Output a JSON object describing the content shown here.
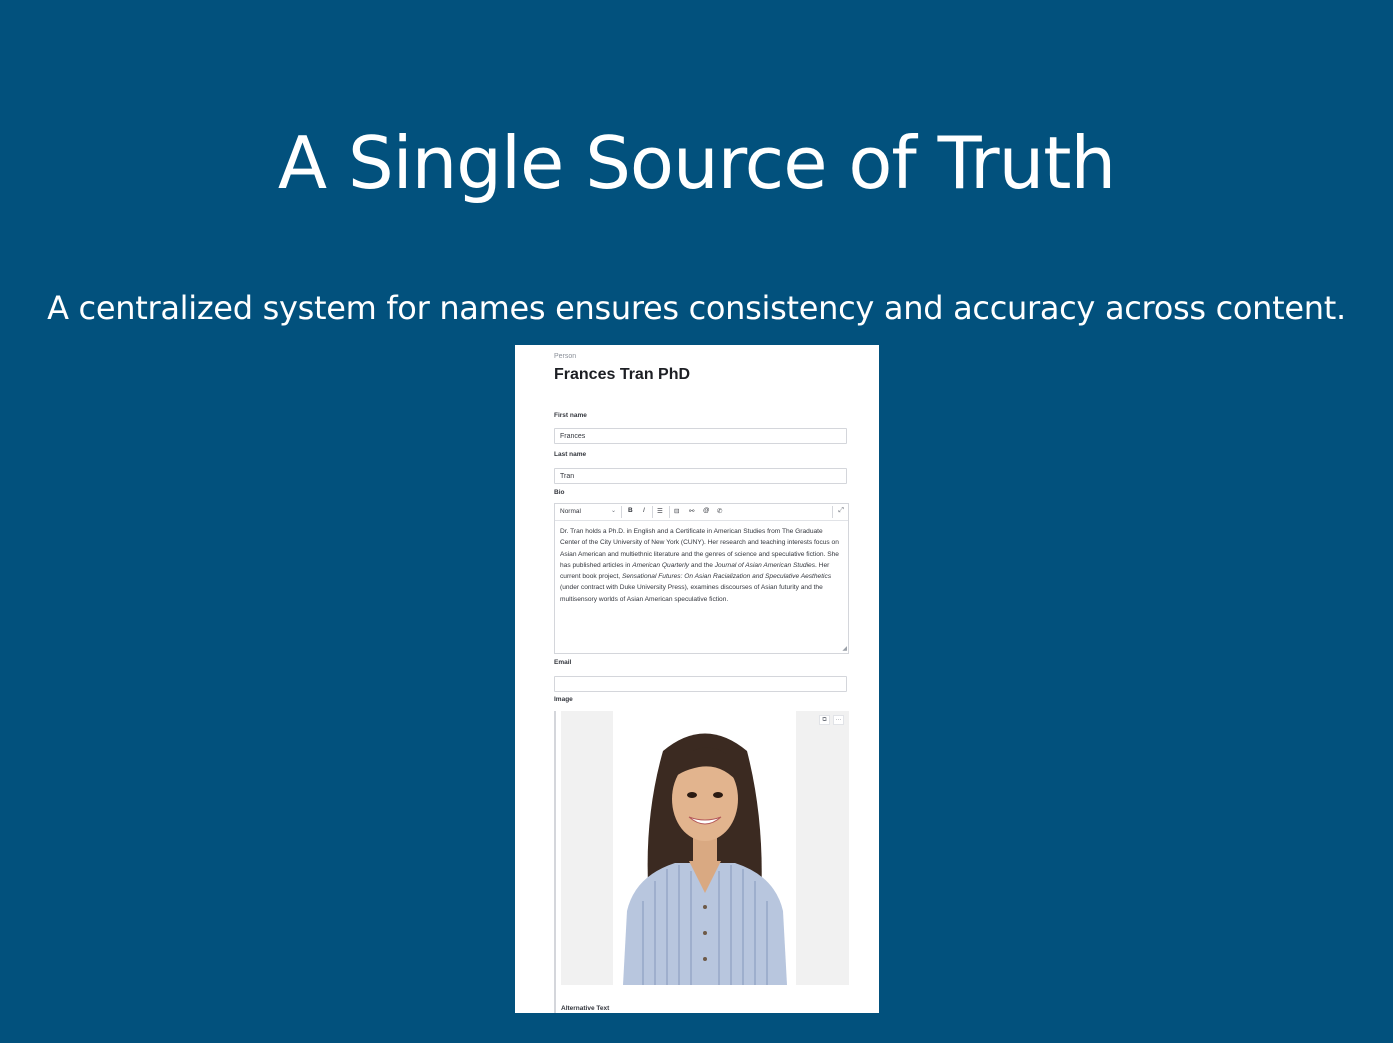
{
  "slide": {
    "title": "A Single Source of Truth",
    "subtitle": "A centralized system for names ensures consistency and accuracy across content."
  },
  "document": {
    "type_label": "Person",
    "title": "Frances Tran PhD"
  },
  "fields": {
    "first_name": {
      "label": "First name",
      "value": "Frances"
    },
    "last_name": {
      "label": "Last name",
      "value": "Tran"
    },
    "bio": {
      "label": "Bio",
      "style_select": "Normal",
      "toolbar": {
        "bold": "B",
        "italic": "I",
        "list": "☰",
        "block": "⊟",
        "link": "⚯",
        "at": "@",
        "phone": "✆",
        "expand": "⤢"
      },
      "text_1": "Dr. Tran holds a Ph.D. in English and a Certificate in American Studies from The Graduate Center of the City University of New York (CUNY). Her research and teaching interests focus on Asian American and multiethnic literature and the genres of science and speculative fiction. She has published articles in ",
      "italic_1": "American Quarterly",
      "text_2": " and the ",
      "italic_2": "Journal of Asian American Studies",
      "text_3": ". Her current book project, ",
      "italic_3": "Sensational Futures: On Asian Racialization and Speculative Aesthetics",
      "text_4": " (under contract with Duke University Press), examines discourses of Asian futurity and the multisensory worlds of Asian American speculative fiction."
    },
    "email": {
      "label": "Email",
      "value": ""
    },
    "image": {
      "label": "Image",
      "alt_label": "Alternative Text"
    }
  },
  "colors": {
    "slide_background": "#02517d",
    "panel_background": "#ffffff",
    "shirt": "#b8c6de"
  }
}
